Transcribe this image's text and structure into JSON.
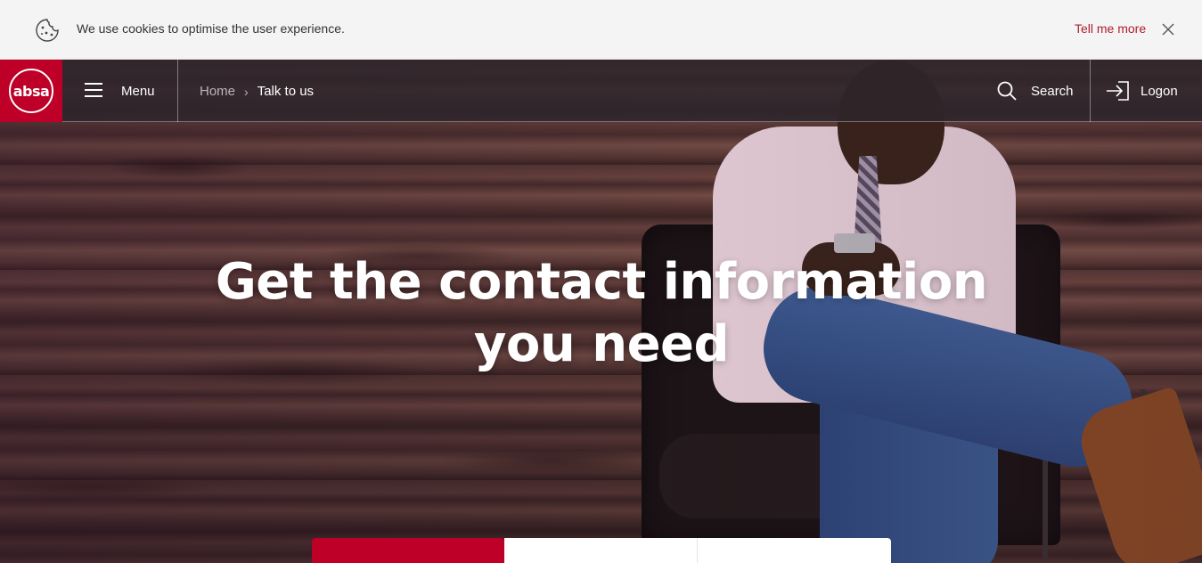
{
  "cookie_bar": {
    "message": "We use cookies to optimise the user experience.",
    "link_label": "Tell me more",
    "link_color": "#af1e2d"
  },
  "header": {
    "logo_text": "absa",
    "brand_color": "#be0028",
    "menu_label": "Menu",
    "breadcrumb": {
      "home": "Home",
      "separator": "›",
      "current": "Talk to us"
    },
    "search_label": "Search",
    "logon_label": "Logon"
  },
  "hero": {
    "title_line1": "Get the contact information",
    "title_line2": "you need"
  },
  "tabs": [
    {
      "label": "",
      "active": true
    },
    {
      "label": "",
      "active": false
    },
    {
      "label": "",
      "active": false
    }
  ]
}
